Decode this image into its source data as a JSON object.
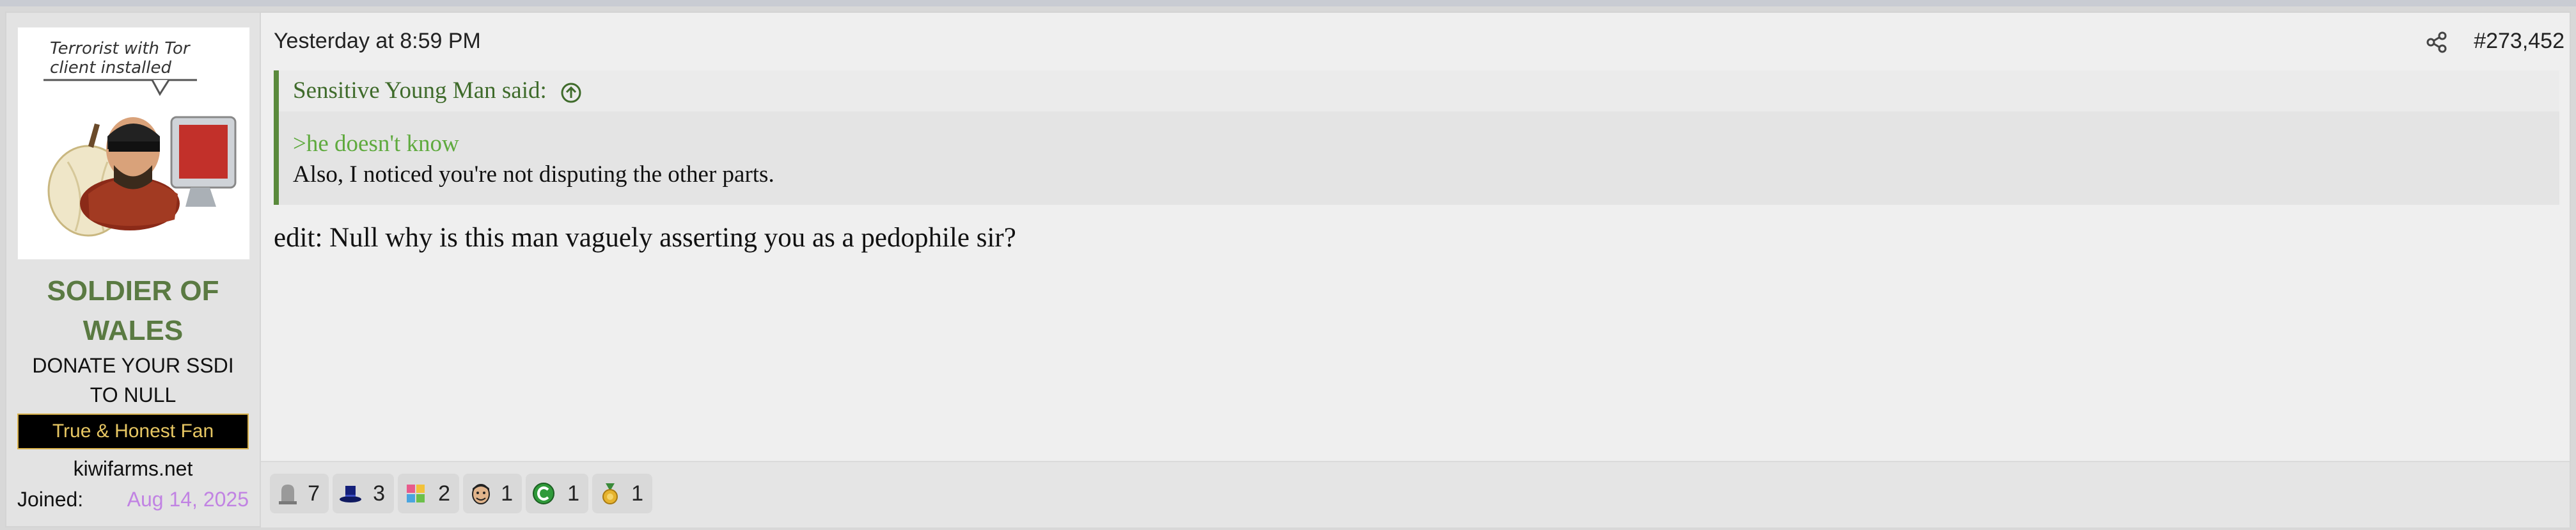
{
  "user": {
    "avatar_caption": "Terrorist with Tor client installed",
    "name": "SOLDIER OF WALES",
    "title": "DONATE YOUR SSDI TO NULL",
    "banner": "True & Honest Fan",
    "website": "kiwifarms.net",
    "joined_label": "Joined:",
    "joined_date": "Aug 14, 2025"
  },
  "post": {
    "timestamp": "Yesterday at 8:59 PM",
    "number": "#273,452",
    "quote": {
      "author_said": "Sensitive Young Man said:",
      "greentext": ">he doesn't know",
      "line": "Also, I noticed you're not disputing the other parts."
    },
    "body": "edit: Null why is this man vaguely asserting you as a pedophile sir?"
  },
  "reactions": [
    {
      "icon": "tombstone-icon",
      "count": "7"
    },
    {
      "icon": "top-hat-icon",
      "count": "3"
    },
    {
      "icon": "puzzle-icon",
      "count": "2"
    },
    {
      "icon": "face-icon",
      "count": "1"
    },
    {
      "icon": "green-c-icon",
      "count": "1"
    },
    {
      "icon": "medal-icon",
      "count": "1"
    }
  ],
  "colors": {
    "accent_green": "#5a7a42",
    "quote_border": "#5a8a3c",
    "greentext": "#5faa3e",
    "joined_date": "#c183e3",
    "banner_text": "#e7c763"
  }
}
